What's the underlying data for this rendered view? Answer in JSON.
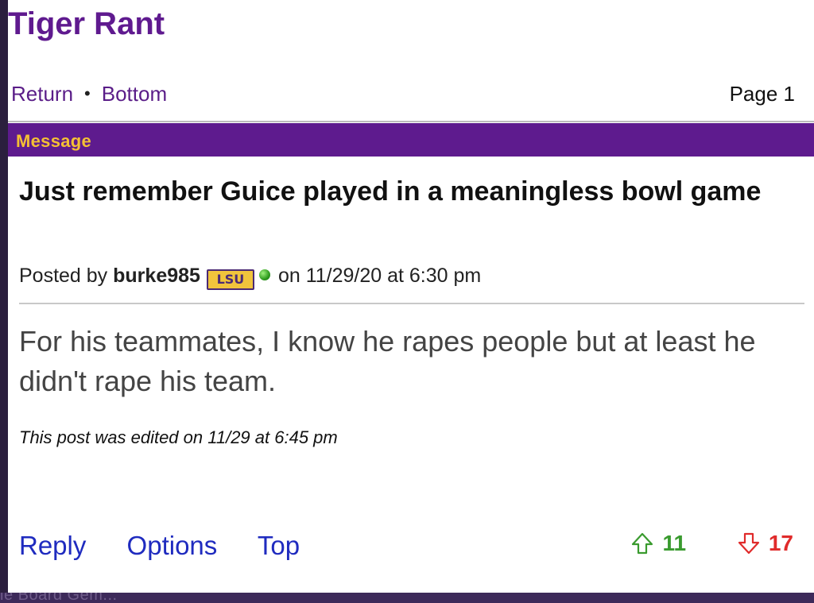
{
  "header": {
    "site_title": "Tiger Rant"
  },
  "nav": {
    "return_label": "Return",
    "separator": "•",
    "bottom_label": "Bottom",
    "page_label": "Page 1"
  },
  "message_bar": {
    "label": "Message"
  },
  "post": {
    "title": "Just remember Guice played in a meaningless bowl game",
    "posted_by_prefix": "Posted by",
    "username": "burke985",
    "team_badge": "LSU",
    "posted_on": "on 11/29/20 at 6:30 pm",
    "body": "For his teammates, I know he rapes people but at least he didn't rape his team.",
    "edit_note": "This post was edited on 11/29 at 6:45 pm"
  },
  "actions": {
    "reply_label": "Reply",
    "options_label": "Options",
    "top_label": "Top"
  },
  "votes": {
    "up_count": "11",
    "down_count": "17",
    "up_color": "#3a9b2f",
    "down_color": "#e02b2b"
  },
  "background_snippet": "le Board Gem..."
}
